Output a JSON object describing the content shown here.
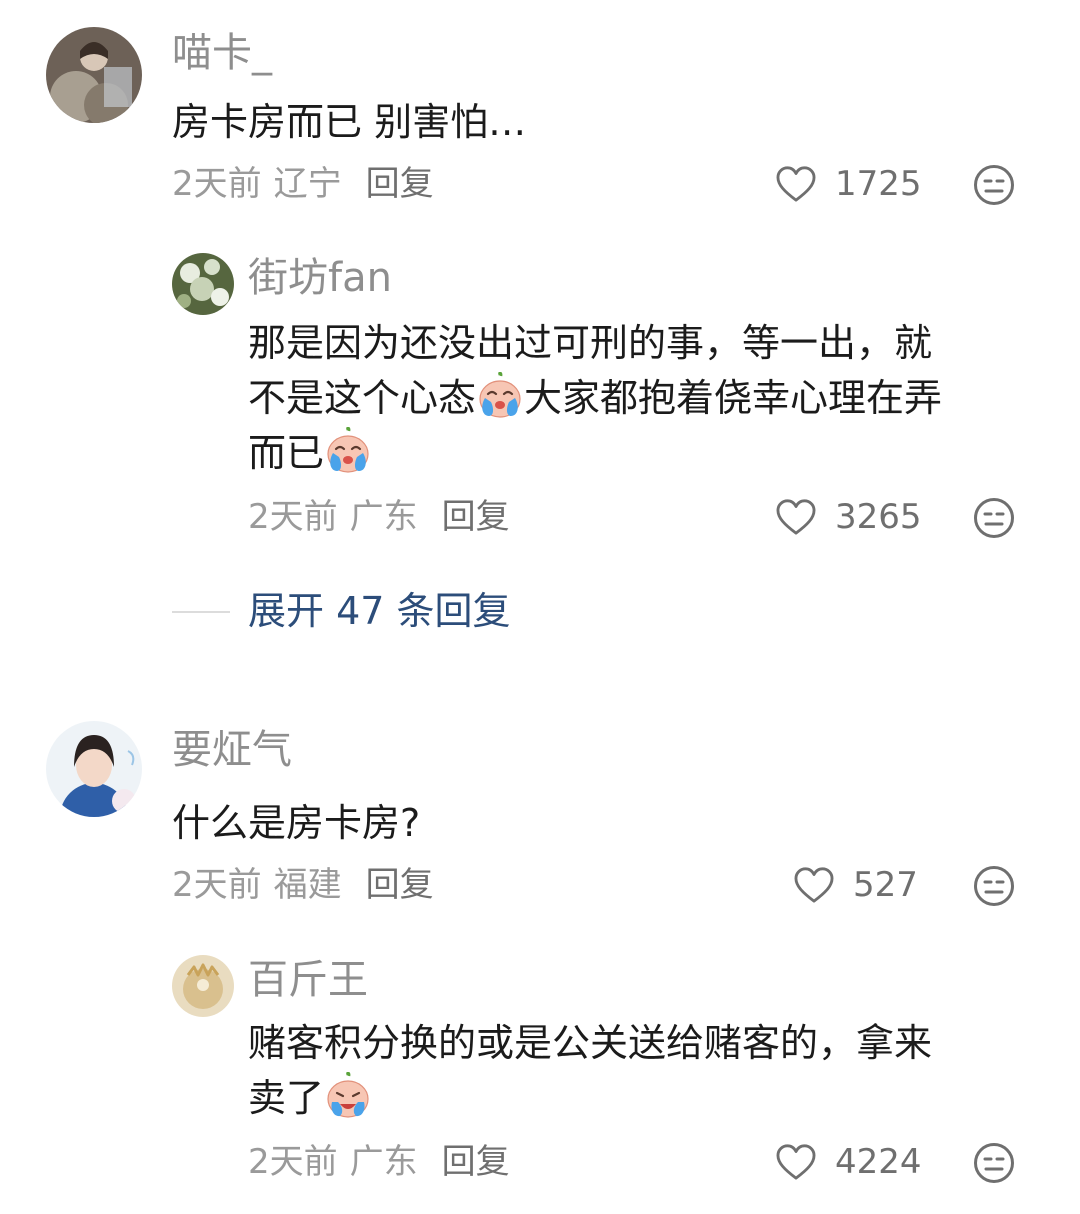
{
  "comments": [
    {
      "username": "喵卡_",
      "text_lines": [
        "房卡房而已 别害怕…"
      ],
      "time": "2天前",
      "location": "辽宁",
      "reply_label": "回复",
      "likes": "1725",
      "replies": [
        {
          "username": "街坊fan",
          "text_lines": [
            "那是因为还没出过可刑的事，等一出，就",
            "不是这个心态",
            "大家都抱着侥幸心理在弄",
            "而已"
          ],
          "time": "2天前",
          "location": "广东",
          "reply_label": "回复",
          "likes": "3265"
        }
      ],
      "expand_label": "展开 47 条回复"
    },
    {
      "username": "要炡气",
      "text_lines": [
        "什么是房卡房?"
      ],
      "time": "2天前",
      "location": "福建",
      "reply_label": "回复",
      "likes": "527",
      "replies": [
        {
          "username": "百斤王",
          "text_lines": [
            "赌客积分换的或是公关送给赌客的，拿来",
            "卖了"
          ],
          "time": "2天前",
          "location": "广东",
          "reply_label": "回复",
          "likes": "4224"
        }
      ]
    }
  ],
  "icons": {
    "like": "heart-outline-icon",
    "dislike": "meh-face-icon",
    "emoji_crying": "crying-face-emoji",
    "emoji_sobbing": "sobbing-face-emoji"
  },
  "colors": {
    "username": "#8e8e8e",
    "text": "#1b1b1b",
    "meta": "#9a9a9a",
    "expand_link": "#2c4d7a"
  }
}
